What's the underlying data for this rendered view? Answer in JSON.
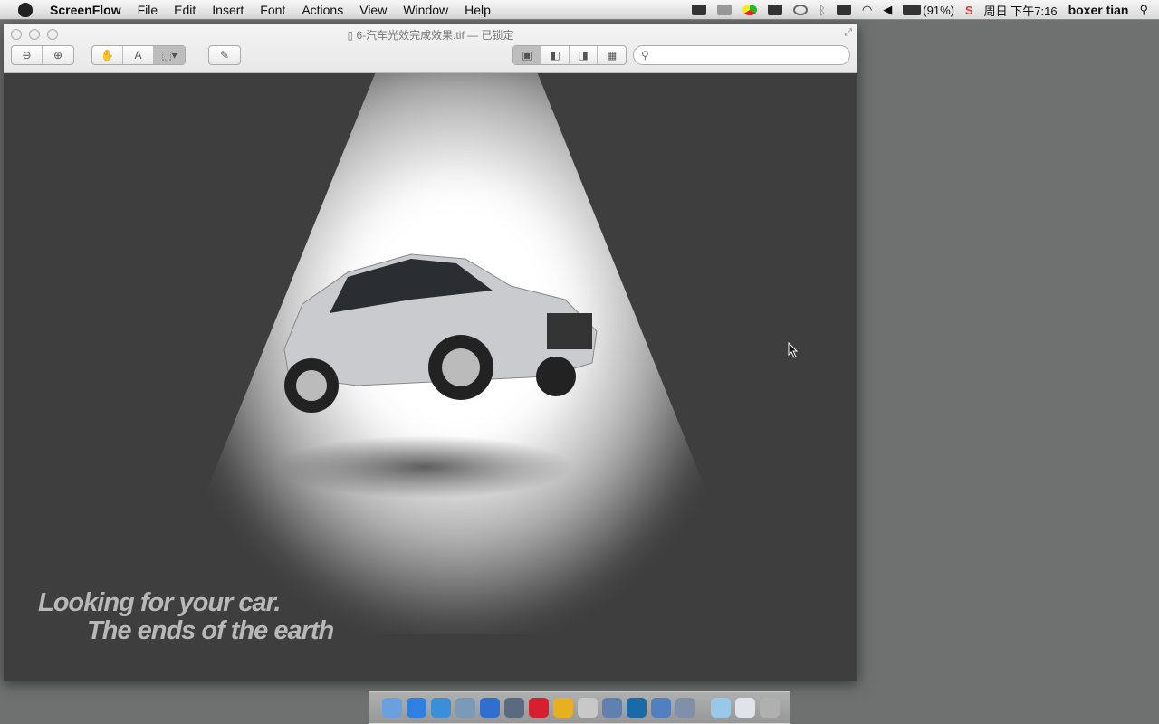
{
  "menubar": {
    "app": "ScreenFlow",
    "items": [
      "File",
      "Edit",
      "Insert",
      "Font",
      "Actions",
      "View",
      "Window",
      "Help"
    ],
    "battery": "(91%)",
    "clock": "周日 下午7:16",
    "user": "boxer tian"
  },
  "window": {
    "title": "6-汽车光效完成效果.tif",
    "locked": "— 已锁定",
    "search_placeholder": ""
  },
  "image": {
    "slogan_line1": "Looking for your car.",
    "slogan_line2": "The ends of the earth"
  },
  "dock": {
    "apps": [
      {
        "name": "finder",
        "color": "#6aa0e0"
      },
      {
        "name": "app-store",
        "color": "#2d7fe0"
      },
      {
        "name": "safari",
        "color": "#3a8fd8"
      },
      {
        "name": "dashboard",
        "color": "#7a9ab8"
      },
      {
        "name": "itunes",
        "color": "#2f6fd0"
      },
      {
        "name": "screenflow",
        "color": "#5a6a80"
      },
      {
        "name": "mail-m",
        "color": "#d62030"
      },
      {
        "name": "chrome",
        "color": "#e8b020"
      },
      {
        "name": "x-app",
        "color": "#c8c8c8"
      },
      {
        "name": "calendar-clock",
        "color": "#6080b0"
      },
      {
        "name": "photoshop",
        "color": "#1a6aa8"
      },
      {
        "name": "image-capture",
        "color": "#5080c0"
      },
      {
        "name": "preview",
        "color": "#8090a8"
      },
      {
        "name": "folder",
        "color": "#9ac8e8"
      },
      {
        "name": "documents",
        "color": "#e0e4ea"
      },
      {
        "name": "trash",
        "color": "#b0b0b0"
      }
    ]
  }
}
